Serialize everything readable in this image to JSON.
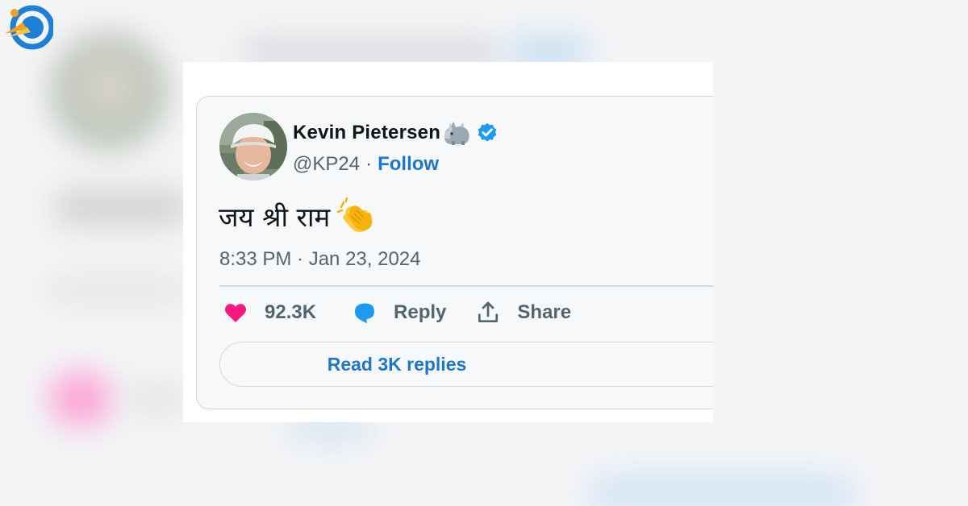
{
  "tweet": {
    "display_name": "Kevin Pietersen",
    "name_emoji": "rhino-emoji",
    "verified_icon": "verified-badge-icon",
    "handle": "@KP24",
    "separator": "·",
    "follow_label": "Follow",
    "text": "जय श्री राम",
    "text_emoji": "clapping-hands-emoji",
    "timestamp": "8:33 PM · Jan 23, 2024",
    "actions": {
      "like_icon": "heart-icon",
      "like_count": "92.3K",
      "reply_icon": "speech-bubble-icon",
      "reply_label": "Reply",
      "share_icon": "share-upload-icon",
      "share_label": "Share"
    },
    "read_replies_label": "Read 3K replies"
  },
  "colors": {
    "accent": "#1d76c9",
    "verified": "#1d9bf0",
    "like": "#f91880",
    "muted_text": "#536471",
    "primary_text": "#0f1419",
    "border": "#cfd9de"
  },
  "branding": {
    "logo_icon": "site-logo-icon"
  }
}
